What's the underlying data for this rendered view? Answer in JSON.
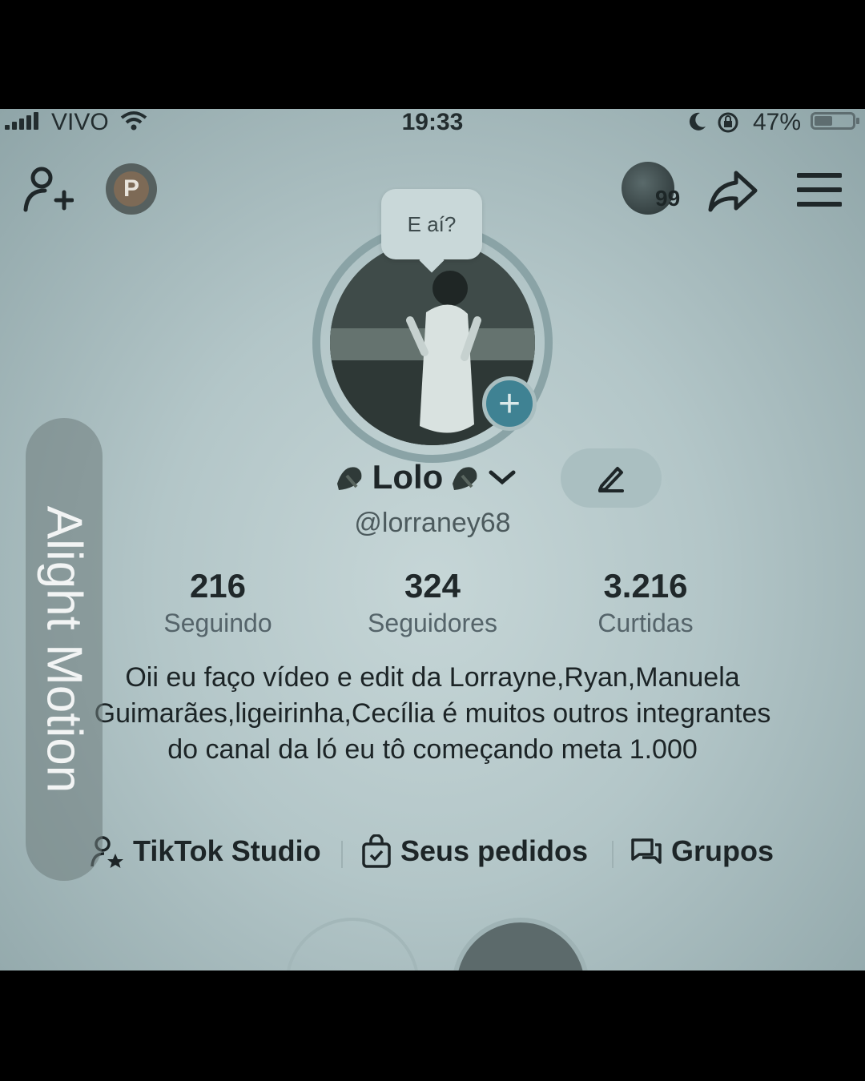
{
  "status_bar": {
    "carrier": "VIVO",
    "time": "19:33",
    "battery_percent": "47%",
    "battery_level": 0.47,
    "icons": [
      "signal-icon",
      "wifi-icon",
      "moon-icon",
      "rotation-lock-icon",
      "battery-icon"
    ]
  },
  "header": {
    "icons": [
      "add-friend-icon",
      "profile-badge-icon",
      "inbox-icon",
      "share-icon",
      "menu-icon"
    ],
    "badge_letter": "P",
    "inbox_count": "99"
  },
  "profile": {
    "note_bubble": "E aí?",
    "name": "Lolo",
    "username": "@lorraney68"
  },
  "stats": [
    {
      "value": "216",
      "label": "Seguindo"
    },
    {
      "value": "324",
      "label": "Seguidores"
    },
    {
      "value": "3.216",
      "label": "Curtidas"
    }
  ],
  "bio": "Oii eu faço vídeo e edit da Lorrayne,Ryan,Manuela Guimarães,ligeirinha,Cecília é muitos outros integrantes do canal da ló eu tô começando meta 1.000",
  "links": [
    {
      "label": "TikTok Studio",
      "icon": "creator-star-icon"
    },
    {
      "label": "Seus pedidos",
      "icon": "shopping-bag-icon"
    },
    {
      "label": "Grupos",
      "icon": "chat-bubbles-icon"
    }
  ],
  "watermark": "Alight Motion",
  "colors": {
    "accent": "#3f8293",
    "background": "#b8cacc",
    "text": "#1e2628"
  }
}
